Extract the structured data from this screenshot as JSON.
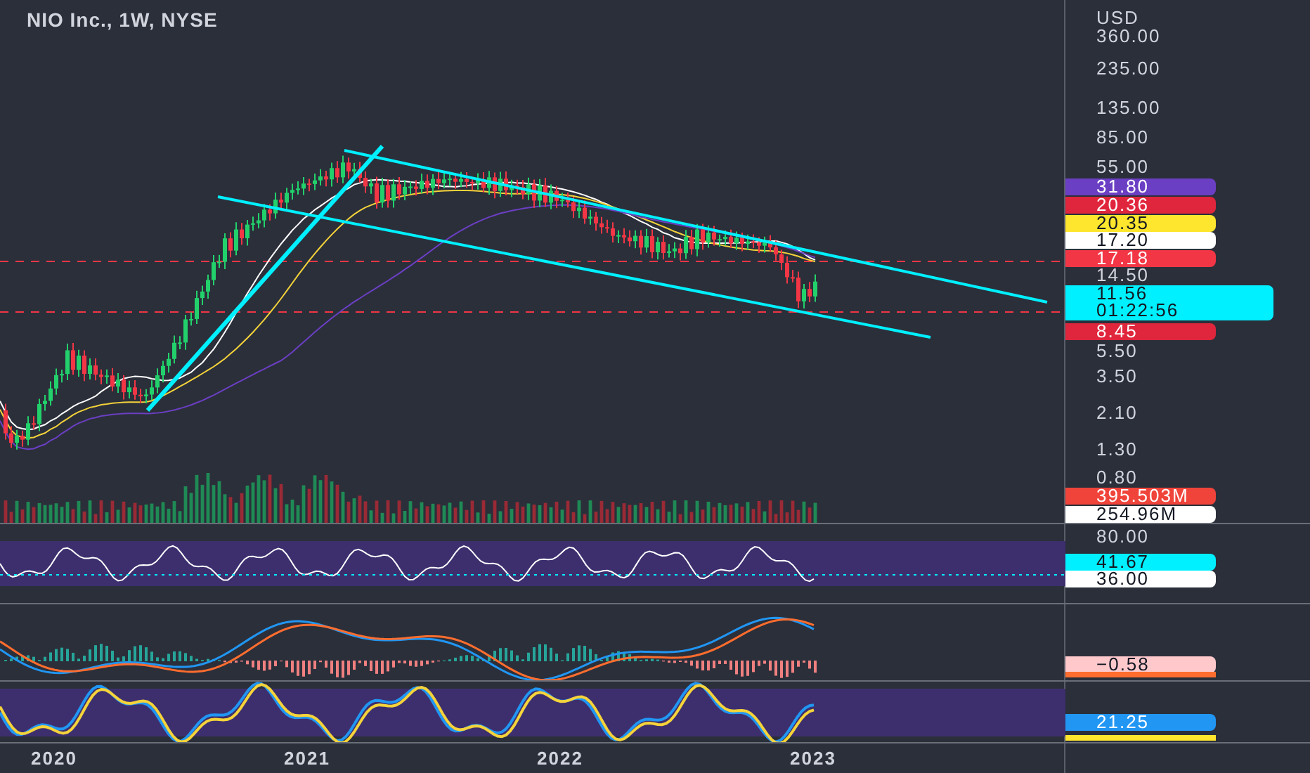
{
  "title": "NIO Inc., 1W, NYSE",
  "price_axis": {
    "currency": "USD",
    "labels": [
      {
        "kind": "tick",
        "text": "360.00"
      },
      {
        "kind": "tick",
        "text": "235.00"
      },
      {
        "kind": "tick",
        "text": "135.00"
      },
      {
        "kind": "tick",
        "text": "85.00"
      },
      {
        "kind": "tick",
        "text": "55.00"
      },
      {
        "kind": "badge",
        "text": "31.80",
        "color": "#6b3fc4"
      },
      {
        "kind": "badge",
        "text": "20.36",
        "color": "#e0263c"
      },
      {
        "kind": "badge",
        "text": "20.35",
        "color": "#ffe62e"
      },
      {
        "kind": "badge",
        "text": "17.20",
        "color": "#ffffff"
      },
      {
        "kind": "badge",
        "text": "17.18",
        "color": "#f23645"
      },
      {
        "kind": "tick",
        "text": "14.50"
      },
      {
        "kind": "badge",
        "text": "11.56",
        "subtext": "01:22:56",
        "color": "#00f0ff"
      },
      {
        "kind": "badge",
        "text": "8.45",
        "color": "#e0263c"
      },
      {
        "kind": "tick",
        "text": "5.50"
      },
      {
        "kind": "tick",
        "text": "3.50"
      },
      {
        "kind": "tick",
        "text": "2.10"
      },
      {
        "kind": "tick",
        "text": "1.30"
      },
      {
        "kind": "tick",
        "text": "0.80"
      },
      {
        "kind": "badge",
        "text": "395.503M",
        "color": "#f0443a"
      },
      {
        "kind": "badge",
        "text": "254.96M",
        "color": "#ffffff"
      }
    ]
  },
  "rsi_axis": {
    "labels": [
      {
        "kind": "tick",
        "text": "80.00"
      },
      {
        "kind": "badge",
        "text": "41.67",
        "color": "#00f0ff"
      },
      {
        "kind": "badge",
        "text": "36.00",
        "color": "#ffffff"
      }
    ]
  },
  "macd_axis": {
    "labels": [
      {
        "kind": "badge",
        "text": "−0.58",
        "color": "#ffc9cc"
      },
      {
        "kind": "strip",
        "color": "#ff6d2e"
      }
    ]
  },
  "stoch_axis": {
    "labels": [
      {
        "kind": "badge",
        "text": "21.25",
        "color": "#2196f3"
      },
      {
        "kind": "strip",
        "color": "#ffe62e"
      }
    ]
  },
  "time_axis": [
    "2020",
    "2021",
    "2022",
    "2023"
  ]
}
